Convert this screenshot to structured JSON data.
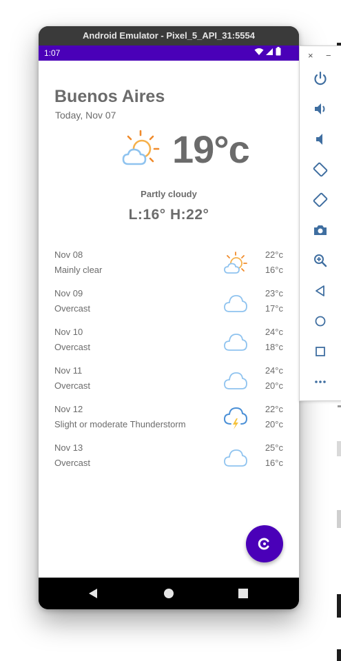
{
  "window": {
    "title": "Android Emulator - Pixel_5_API_31:5554"
  },
  "statusbar": {
    "time": "1:07"
  },
  "weather": {
    "city": "Buenos Aires",
    "date": "Today, Nov 07",
    "temperature": "19°c",
    "condition": "Partly cloudy",
    "hilo": "L:16° H:22°",
    "icon": "partly-cloudy-sun-icon"
  },
  "forecast": [
    {
      "date": "Nov 08",
      "desc": "Mainly clear",
      "hi": "22°c",
      "lo": "16°c",
      "icon": "partly-cloudy-icon"
    },
    {
      "date": "Nov 09",
      "desc": "Overcast",
      "hi": "23°c",
      "lo": "17°c",
      "icon": "cloud-icon"
    },
    {
      "date": "Nov 10",
      "desc": "Overcast",
      "hi": "24°c",
      "lo": "18°c",
      "icon": "cloud-icon"
    },
    {
      "date": "Nov 11",
      "desc": "Overcast",
      "hi": "24°c",
      "lo": "20°c",
      "icon": "cloud-icon"
    },
    {
      "date": "Nov 12",
      "desc": "Slight or moderate Thunderstorm",
      "hi": "22°c",
      "lo": "20°c",
      "icon": "thunderstorm-icon"
    },
    {
      "date": "Nov 13",
      "desc": "Overcast",
      "hi": "25°c",
      "lo": "16°c",
      "icon": "cloud-icon"
    }
  ],
  "sidebar": {
    "close": "×",
    "minimize": "−",
    "tools": [
      "power-icon",
      "volume-up-icon",
      "volume-down-icon",
      "rotate-left-icon",
      "rotate-right-icon",
      "camera-icon",
      "zoom-icon",
      "back-icon",
      "home-icon",
      "overview-icon",
      "more-icon"
    ]
  },
  "colors": {
    "accent": "#4a00b8",
    "text": "#6b6b6b",
    "sun": "#f08a2b",
    "cloud": "#8fc3ef"
  }
}
